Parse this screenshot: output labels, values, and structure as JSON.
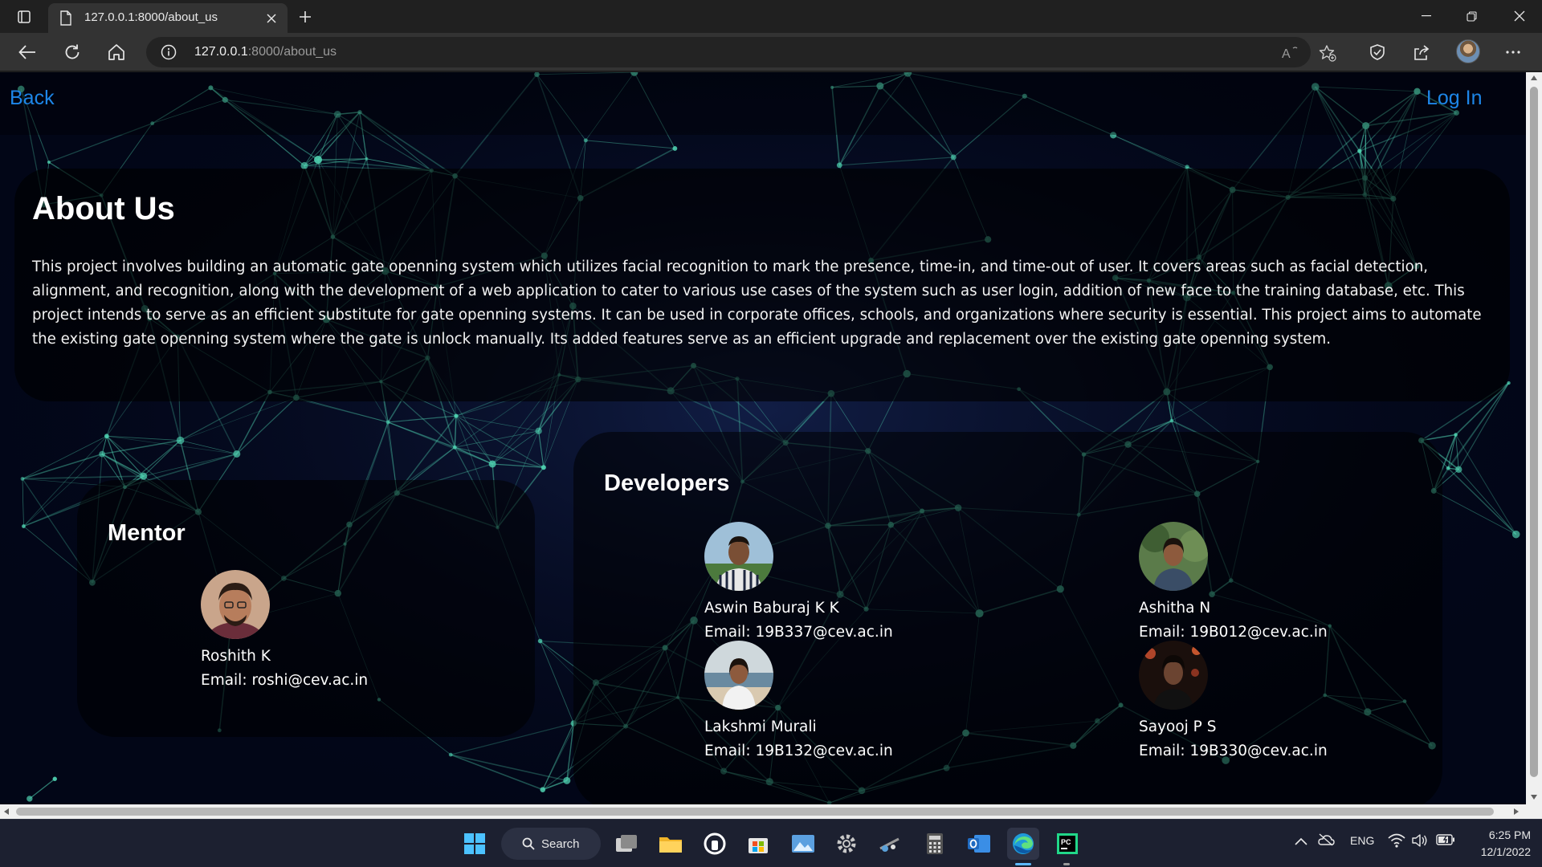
{
  "browser": {
    "tab_title": "127.0.0.1:8000/about_us",
    "url_host": "127.0.0.1",
    "url_rest": ":8000/about_us"
  },
  "nav": {
    "back_label": "Back",
    "login_label": "Log In"
  },
  "about": {
    "heading": "About Us",
    "body": "This project involves building an automatic gate openning system which utilizes facial recognition to mark the presence, time-in, and time-out of user. It covers areas such as facial detection, alignment, and recognition, along with the development of a web application to cater to various use cases of the system such as user login, addition of new face to the training database, etc. This project intends to serve as an efficient substitute for gate openning systems. It can be used in corporate offices, schools, and organizations where security is essential. This project aims to automate the existing gate openning system where the gate is unlock manually. Its added features serve as an efficient upgrade and replacement over the existing gate openning system."
  },
  "mentor": {
    "heading": "Mentor",
    "name": "Roshith K",
    "email": "Email: roshi@cev.ac.in"
  },
  "developers": {
    "heading": "Developers",
    "people": [
      {
        "name": "Aswin Baburaj K K",
        "email": "Email: 19B337@cev.ac.in"
      },
      {
        "name": "Ashitha N",
        "email": "Email: 19B012@cev.ac.in"
      },
      {
        "name": "Lakshmi Murali",
        "email": "Email: 19B132@cev.ac.in"
      },
      {
        "name": "Sayooj P S",
        "email": "Email: 19B330@cev.ac.in"
      }
    ]
  },
  "taskbar": {
    "search_label": "Search",
    "language": "ENG",
    "time": "6:25 PM",
    "date": "12/1/2022"
  },
  "colors": {
    "link": "#1d86e8",
    "network": "#4fd1b0",
    "page_bg": "#020617"
  }
}
